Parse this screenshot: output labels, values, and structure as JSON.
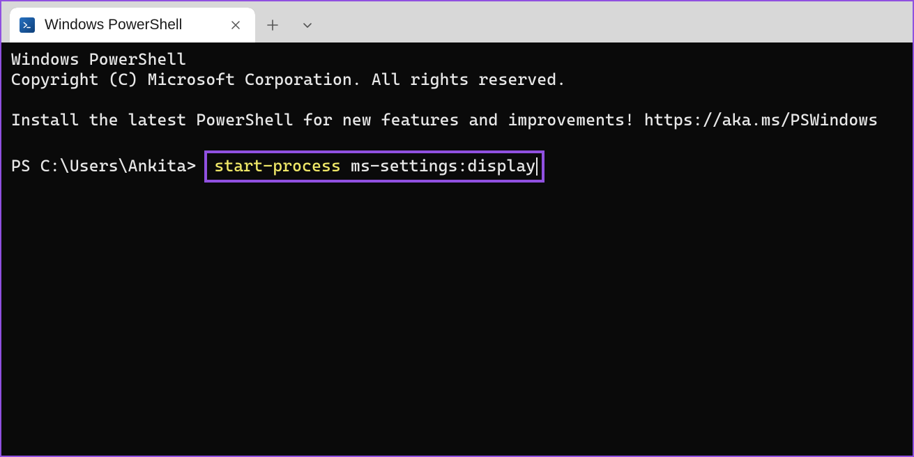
{
  "tab": {
    "title": "Windows PowerShell",
    "icon_name": "powershell-icon"
  },
  "terminal": {
    "line1": "Windows PowerShell",
    "line2": "Copyright (C) Microsoft Corporation. All rights reserved.",
    "line3": "Install the latest PowerShell for new features and improvements! https://aka.ms/PSWindows",
    "prompt": "PS C:\\Users\\Ankita> ",
    "command_part1": "start-process",
    "command_sep": " ",
    "command_part2": "ms-settings:display"
  },
  "colors": {
    "accent": "#9050e0",
    "terminal_bg": "#0a0a0a",
    "terminal_fg": "#e8e8e8",
    "highlight_yellow": "#f0e868"
  }
}
